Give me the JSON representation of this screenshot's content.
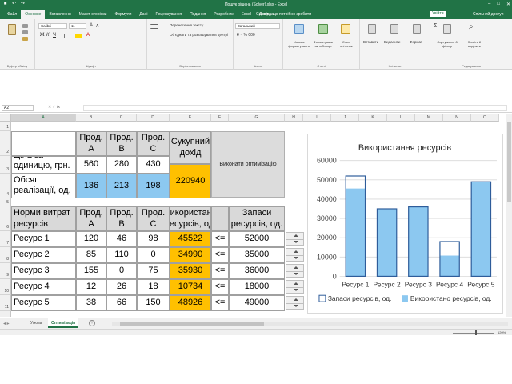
{
  "window": {
    "title": "Пошук рішень (Solver).xlsx  -  Excel"
  },
  "menu": {
    "tabs": [
      "Файл",
      "Основне",
      "Вставлення",
      "Макет сторінки",
      "Формули",
      "Дані",
      "Рецензування",
      "Подання",
      "Розробник",
      "Excel",
      "Довідка"
    ],
    "active_tab": "Основне",
    "tell_me": "Скажіть, що потрібно зробити",
    "sign_in": "Увійти",
    "share": "Спільний доступ"
  },
  "ribbon": {
    "groups": [
      "Буфер обміну",
      "Шрифт",
      "Вирівнювання",
      "Число",
      "Стилі",
      "Клітинки",
      "Редагування"
    ],
    "font_name": "Calibri",
    "font_size": "11",
    "wrap_text": "Перенесення тексту",
    "merge_center": "Об'єднати та розташувати в центрі",
    "number_format": "Загальний",
    "styles": [
      "Умовне форматування",
      "Форматувати як таблицю",
      "Стилі клітинок"
    ],
    "cells": [
      "Вставити",
      "Видалити",
      "Формат"
    ],
    "editing": [
      "Сортування й фільтр",
      "Знайти й виділити"
    ]
  },
  "formula_bar": {
    "name_box": "A2",
    "fx": "fx",
    "value": ""
  },
  "columns": [
    "A",
    "B",
    "C",
    "D",
    "E",
    "F",
    "G",
    "H",
    "I",
    "J",
    "K",
    "L",
    "M",
    "N",
    "O"
  ],
  "rows": [
    "1",
    "2",
    "3",
    "4",
    "5",
    "6",
    "7",
    "8",
    "9",
    "10",
    "11",
    "12"
  ],
  "table1": {
    "headers": [
      "Прод. A",
      "Прод. B",
      "Прод. C",
      "Сукупний дохід"
    ],
    "price_label": "Ціна за одиницю, грн.",
    "prices": [
      "560",
      "280",
      "430"
    ],
    "volume_label": "Обсяг реалізації, од.",
    "volumes": [
      "136",
      "213",
      "198"
    ],
    "total_income": "220940"
  },
  "optimize_button": "Виконати оптимізацію",
  "table2": {
    "header_norms": "Норми витрат ресурсів",
    "headers": [
      "Прод. A",
      "Прод. B",
      "Прод. C",
      "Використано ресурсів, од.",
      "",
      "Запаси ресурсів, од."
    ],
    "rows": [
      {
        "name": "Ресурс 1",
        "a": "120",
        "b": "46",
        "c": "98",
        "used": "45522",
        "op": "<=",
        "stock": "52000"
      },
      {
        "name": "Ресурс 2",
        "a": "85",
        "b": "110",
        "c": "0",
        "used": "34990",
        "op": "<=",
        "stock": "35000"
      },
      {
        "name": "Ресурс 3",
        "a": "155",
        "b": "0",
        "c": "75",
        "used": "35930",
        "op": "<=",
        "stock": "36000"
      },
      {
        "name": "Ресурс 4",
        "a": "12",
        "b": "26",
        "c": "18",
        "used": "10734",
        "op": "<=",
        "stock": "18000"
      },
      {
        "name": "Ресурс 5",
        "a": "38",
        "b": "66",
        "c": "150",
        "used": "48926",
        "op": "<=",
        "stock": "49000"
      }
    ]
  },
  "chart_data": {
    "type": "bar",
    "title": "Використання ресурсів",
    "categories": [
      "Ресурс 1",
      "Ресурс 2",
      "Ресурс 3",
      "Ресурс 4",
      "Ресурс 5"
    ],
    "series": [
      {
        "name": "Запаси ресурсів, од.",
        "values": [
          52000,
          35000,
          36000,
          18000,
          49000
        ],
        "style": "outline",
        "color": "#2e5c9a"
      },
      {
        "name": "Використано ресурсів, од.",
        "values": [
          45522,
          34990,
          35930,
          10734,
          48926
        ],
        "style": "fill",
        "color": "#8cc8f0"
      }
    ],
    "ylim": [
      0,
      60000
    ],
    "yticks": [
      "0",
      "10000",
      "20000",
      "30000",
      "40000",
      "50000",
      "60000"
    ],
    "grid": true,
    "legend": "bottom"
  },
  "sheets": {
    "tabs": [
      "Умова",
      "Оптимізація"
    ],
    "active": "Оптимізація"
  },
  "status": {
    "zoom": "120%"
  },
  "colors": {
    "excel_green": "#217346",
    "highlight_blue": "#8cc8f0",
    "highlight_orange": "#ffc000"
  }
}
